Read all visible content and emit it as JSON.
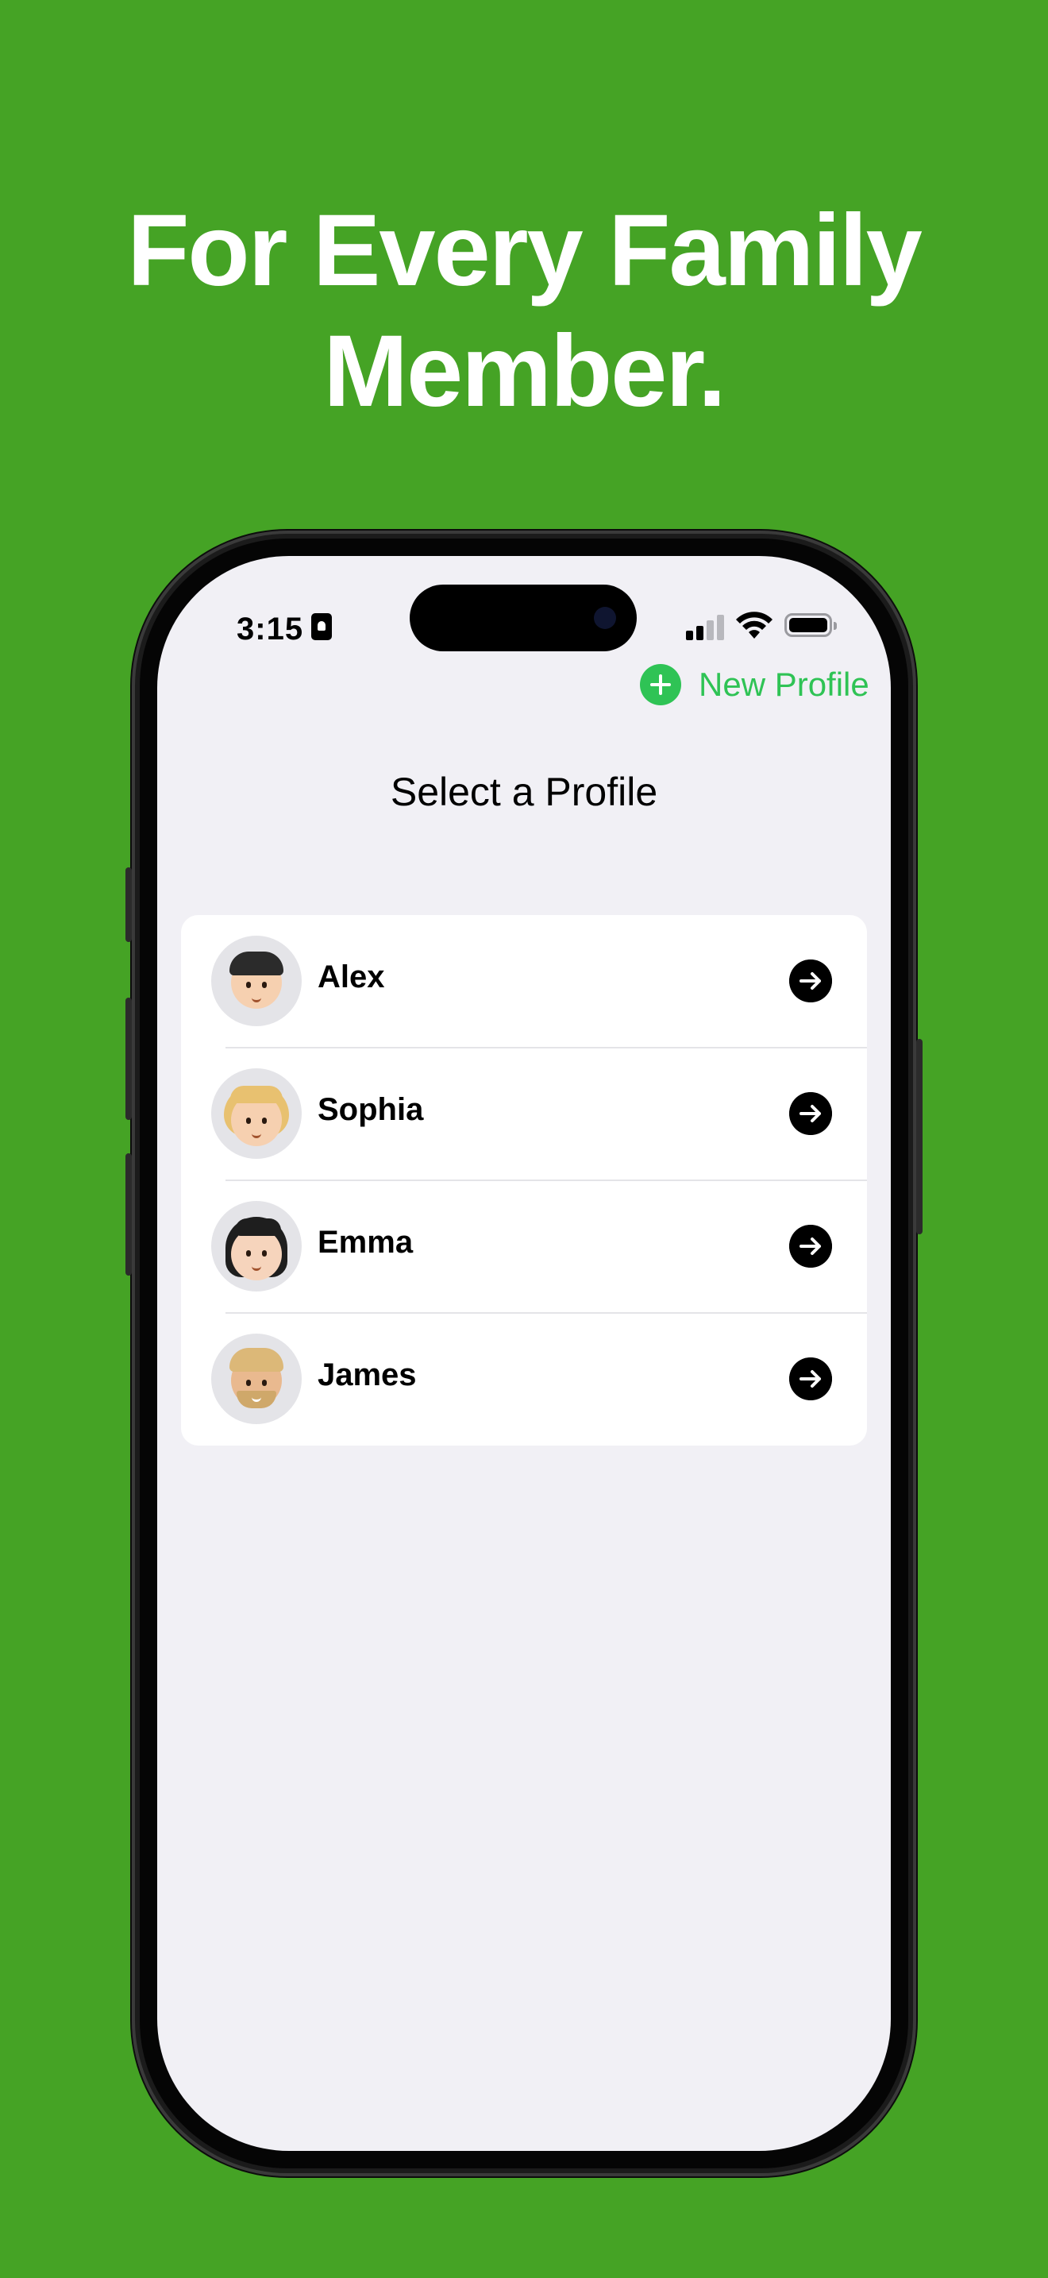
{
  "headline": {
    "line1": "For Every Family",
    "line2": "Member."
  },
  "status_bar": {
    "time": "3:15"
  },
  "nav": {
    "new_profile_label": "New Profile"
  },
  "title": "Select a Profile",
  "profiles": [
    {
      "name": "Alex",
      "avatar": "boy-avatar-icon"
    },
    {
      "name": "Sophia",
      "avatar": "girl-blonde-avatar-icon"
    },
    {
      "name": "Emma",
      "avatar": "woman-dark-hair-avatar-icon"
    },
    {
      "name": "James",
      "avatar": "man-blond-avatar-icon"
    }
  ],
  "colors": {
    "background": "#45a325",
    "accent": "#2fc355",
    "screen": "#f1f0f5"
  }
}
